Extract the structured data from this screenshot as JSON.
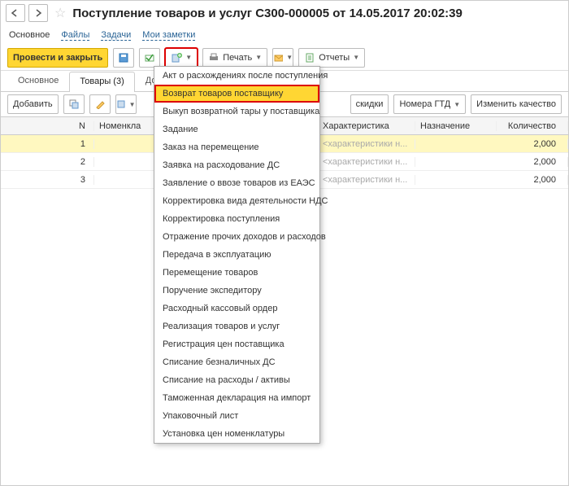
{
  "title": "Поступление товаров и услуг С300-000005 от 14.05.2017 20:02:39",
  "links": {
    "main": "Основное",
    "files": "Файлы",
    "tasks": "Задачи",
    "notes": "Мои заметки"
  },
  "toolbar": {
    "post_close": "Провести и закрыть",
    "print": "Печать",
    "reports": "Отчеты"
  },
  "tabs": {
    "main": "Основное",
    "goods": "Товары (3)",
    "delivery": "Доставка"
  },
  "sub": {
    "add": "Добавить",
    "discounts": "скидки",
    "gtd": "Номера ГТД",
    "quality": "Изменить качество"
  },
  "grid": {
    "headers": {
      "n": "N",
      "nom": "Номенкла",
      "char": "Характеристика",
      "naz": "Назначение",
      "qty": "Количество"
    },
    "rows": [
      {
        "n": "1",
        "char": "<характеристики н...",
        "qty": "2,000"
      },
      {
        "n": "2",
        "char": "<характеристики н...",
        "qty": "2,000"
      },
      {
        "n": "3",
        "char": "<характеристики н...",
        "qty": "2,000"
      }
    ]
  },
  "menu": [
    "Акт о расхождениях после поступления",
    "Возврат товаров поставщику",
    "Выкуп возвратной тары у поставщика",
    "Задание",
    "Заказ на перемещение",
    "Заявка на расходование ДС",
    "Заявление о ввозе товаров из ЕАЭС",
    "Корректировка вида деятельности НДС",
    "Корректировка поступления",
    "Отражение прочих доходов и расходов",
    "Передача в эксплуатацию",
    "Перемещение товаров",
    "Поручение экспедитору",
    "Расходный кассовый ордер",
    "Реализация товаров и услуг",
    "Регистрация цен поставщика",
    "Списание безналичных ДС",
    "Списание на расходы / активы",
    "Таможенная декларация на импорт",
    "Упаковочный лист",
    "Установка цен номенклатуры"
  ],
  "menu_highlight": 1
}
